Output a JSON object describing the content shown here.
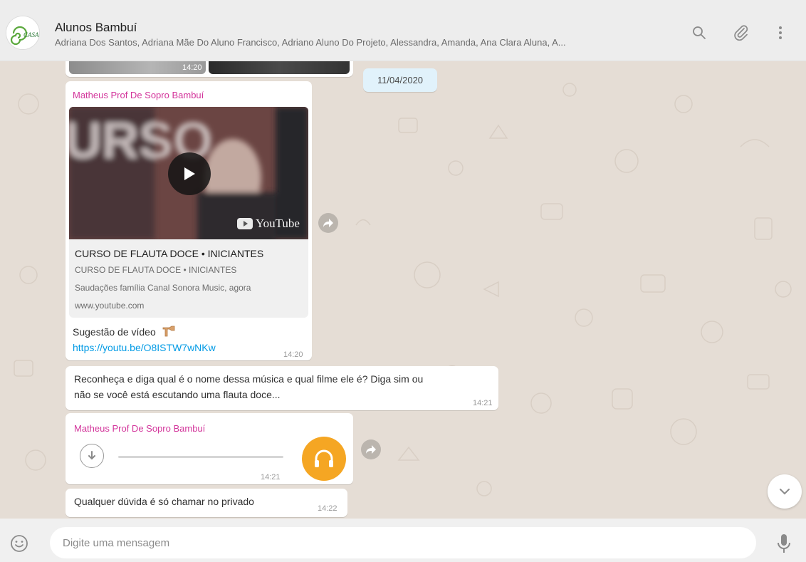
{
  "header": {
    "group_name": "Alunos Bambuí",
    "members": "Adriana Dos Santos, Adriana Mãe Do Aluno Francisco, Adriano Aluno Do Projeto, Alessandra, Amanda, Ana Clara Aluna, A...",
    "avatar_text": "CASA",
    "icons": [
      "search-icon",
      "attach-icon",
      "menu-icon"
    ]
  },
  "chat": {
    "date_chip": "11/04/2020",
    "prev_message": {
      "time": "14:20"
    },
    "link_message": {
      "sender": "Matheus Prof De Sopro Bambuí",
      "video_overlay_text": "URSO",
      "youtube_label": "YouTube",
      "preview_title": "CURSO DE FLAUTA DOCE • INICIANTES",
      "preview_subtitle": "CURSO DE FLAUTA DOCE • INICIANTES",
      "preview_description": "Saudações família Canal Sonora Music, agora",
      "preview_domain": "www.youtube.com",
      "text": "Sugestão de vídeo",
      "url": "https://youtu.be/O8ISTW7wNKw",
      "time": "14:20"
    },
    "text_message": {
      "line1": "Reconheça e diga qual é o nome dessa música e qual filme ele é? Diga sim ou",
      "line2": "não se você está escutando uma flauta doce...",
      "time": "14:21"
    },
    "audio_message": {
      "sender": "Matheus Prof De Sopro Bambuí",
      "time": "14:21",
      "avatar_color": "#f5a623"
    },
    "last_message": {
      "text": "Qualquer dúvida é só chamar no privado",
      "time": "14:22"
    }
  },
  "composer": {
    "placeholder": "Digite uma mensagem",
    "icons": [
      "emoji-icon",
      "mic-icon"
    ]
  },
  "colors": {
    "sender": "#d3359b",
    "link": "#039be5",
    "chat_background": "#e5ddd5",
    "date_chip": "#e1f2fb"
  }
}
